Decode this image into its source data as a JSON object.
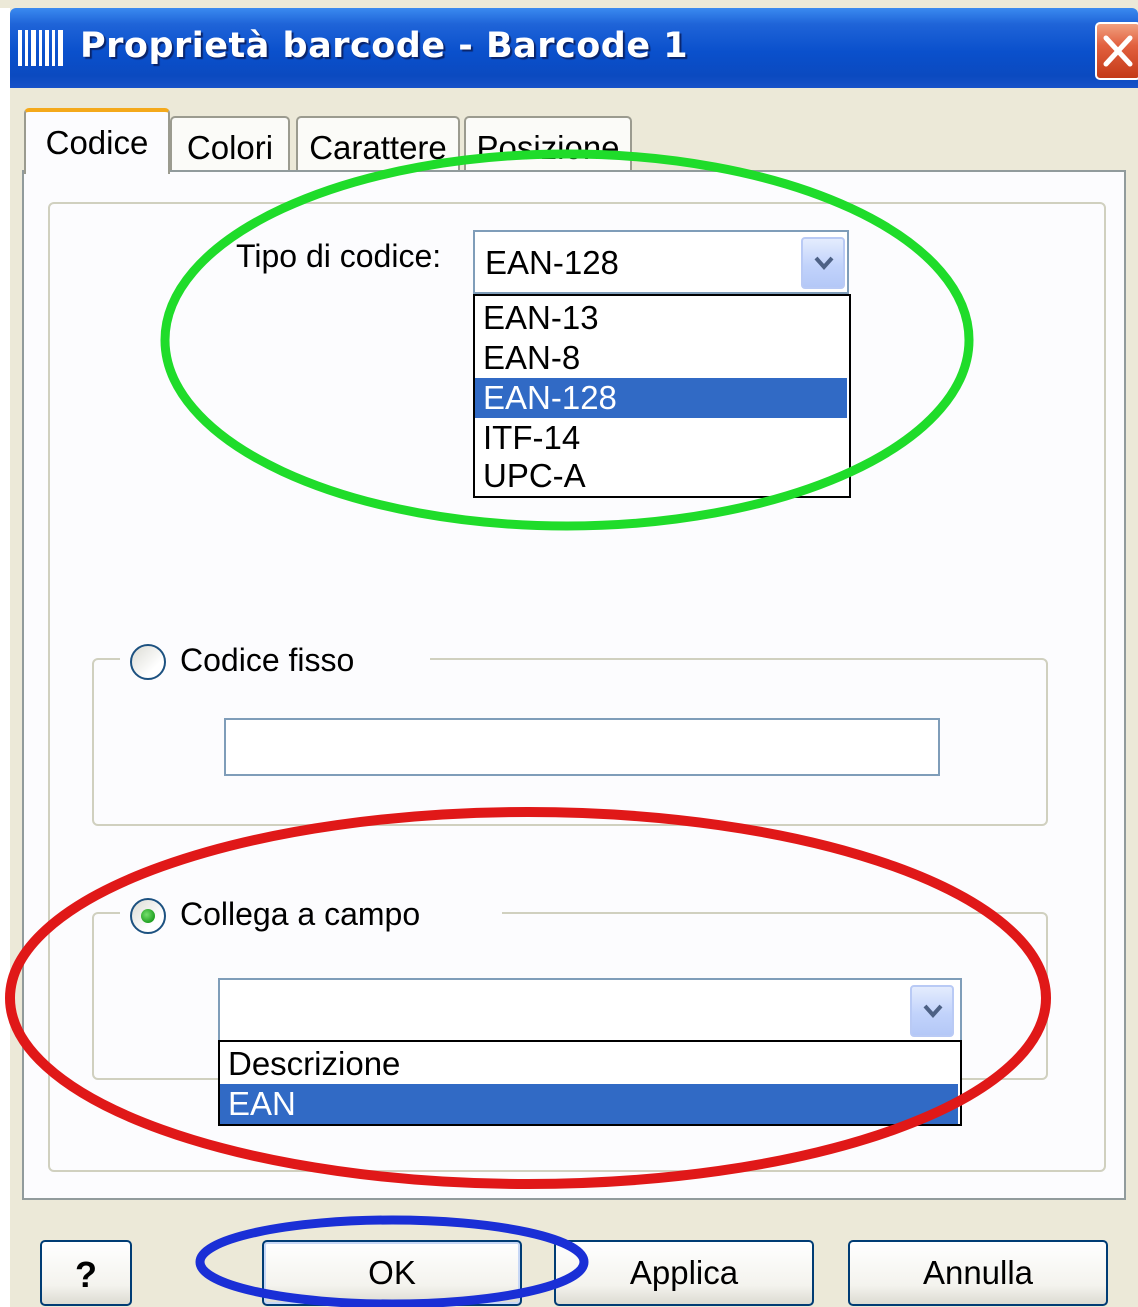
{
  "window": {
    "title": "Proprietà barcode - Barcode 1",
    "icon": "barcode-icon",
    "close_icon": "close-icon"
  },
  "tabs": [
    {
      "label": "Codice",
      "active": true
    },
    {
      "label": "Colori",
      "active": false
    },
    {
      "label": "Carattere",
      "active": false
    },
    {
      "label": "Posizione",
      "active": false
    }
  ],
  "code_type": {
    "label": "Tipo di codice:",
    "value": "EAN-128",
    "options": [
      "EAN-13",
      "EAN-8",
      "EAN-128",
      "ITF-14",
      "UPC-A"
    ],
    "selected_option": "EAN-128"
  },
  "fixed_code": {
    "label": "Codice fisso",
    "checked": false,
    "value": ""
  },
  "link_field": {
    "label": "Collega a campo",
    "checked": true,
    "value": "",
    "options": [
      "Descrizione",
      "EAN"
    ],
    "selected_option": "EAN"
  },
  "buttons": {
    "help_label": "?",
    "ok_label": "OK",
    "apply_label": "Applica",
    "cancel_label": "Annulla"
  },
  "annotations": {
    "green": "#1fdc2a",
    "red": "#e01818",
    "blue": "#1a2fd6"
  }
}
